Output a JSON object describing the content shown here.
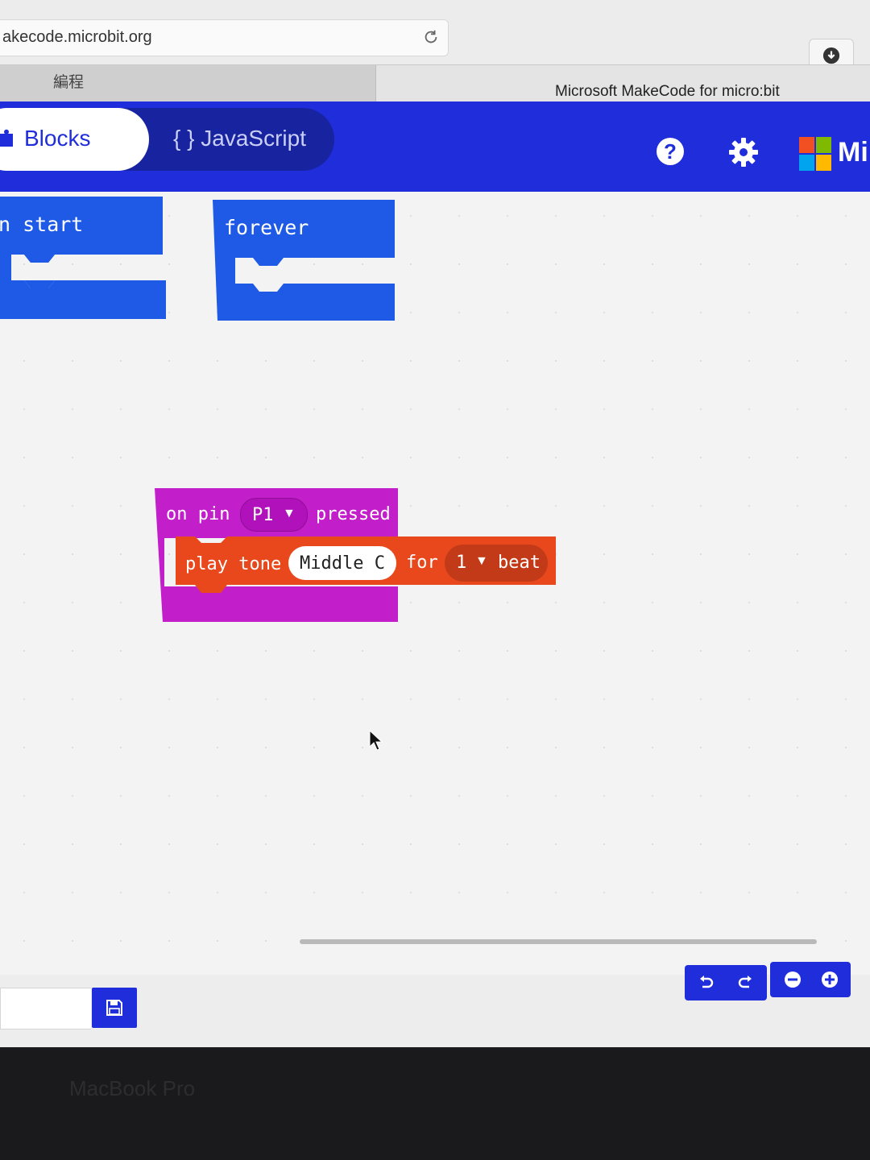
{
  "browser": {
    "url": "akecode.microbit.org",
    "inactive_tab": "編程",
    "active_tab": "Microsoft MakeCode for micro:bit"
  },
  "header": {
    "tabs": [
      {
        "label": "Blocks",
        "icon": "puzzle-piece-icon",
        "selected": true
      },
      {
        "label": "{ } JavaScript",
        "selected": false
      }
    ],
    "brand_text": "Mi",
    "colors": {
      "header": "#1f2ddb",
      "blocks_basic": "#1e5ae6",
      "blocks_input": "#c21ec9",
      "blocks_music": "#e8481c"
    }
  },
  "blocks": {
    "on_start_label": "n  start",
    "forever_label": "forever",
    "pin_event": {
      "prefix": "on pin",
      "pin": "P1",
      "suffix": "pressed"
    },
    "play_tone": {
      "label": "play tone",
      "note": "Middle C",
      "for_label": "for",
      "beats": "1",
      "beat_label": "beat"
    }
  },
  "bottom": {
    "bezel_text": "MacBook Pro"
  }
}
